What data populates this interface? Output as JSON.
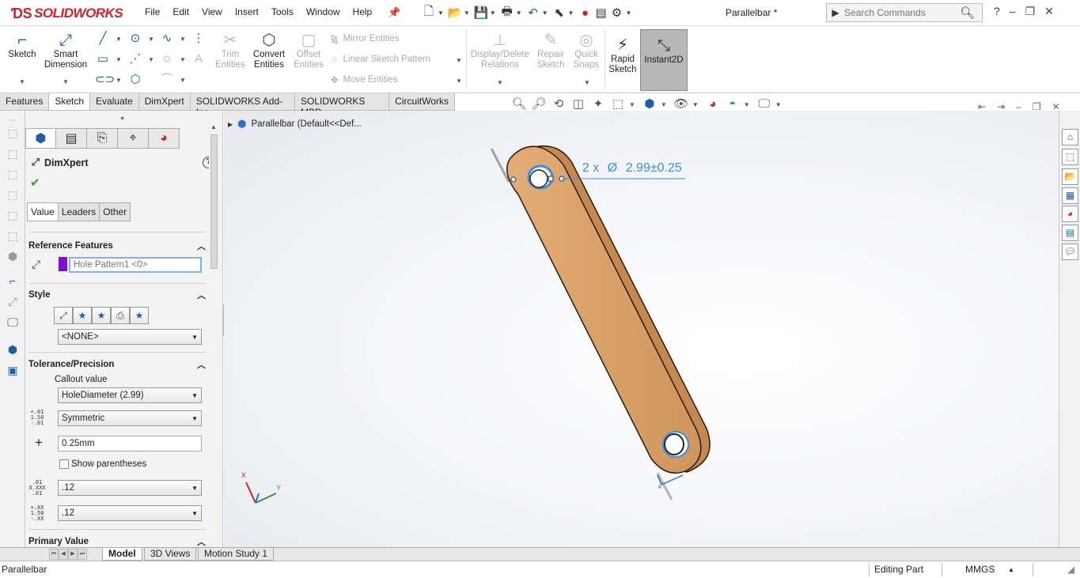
{
  "app": {
    "logo_text": "SOLIDWORKS",
    "document_title": "Parallelbar *",
    "menu": [
      "File",
      "Edit",
      "View",
      "Insert",
      "Tools",
      "Window",
      "Help"
    ],
    "search_placeholder": "Search Commands",
    "help_glyph": "?"
  },
  "ribbon": {
    "sketch": "Sketch",
    "smart_dimension_1": "Smart",
    "smart_dimension_2": "Dimension",
    "trim_1": "Trim",
    "trim_2": "Entities",
    "convert_1": "Convert",
    "convert_2": "Entities",
    "offset_1": "Offset",
    "offset_2": "Entities",
    "mirror": "Mirror Entities",
    "linear_pattern": "Linear Sketch Pattern",
    "move": "Move Entities",
    "display_delete_1": "Display/Delete",
    "display_delete_2": "Relations",
    "repair_1": "Repair",
    "repair_2": "Sketch",
    "quick_snaps_1": "Quick",
    "quick_snaps_2": "Snaps",
    "rapid_1": "Rapid",
    "rapid_2": "Sketch",
    "instant2d": "Instant2D"
  },
  "tabs": [
    "Features",
    "Sketch",
    "Evaluate",
    "DimXpert",
    "SOLIDWORKS Add-Ins",
    "SOLIDWORKS MBD",
    "CircuitWorks"
  ],
  "active_tab": "Sketch",
  "property_manager": {
    "title": "DimXpert",
    "subtabs": [
      "Value",
      "Leaders",
      "Other"
    ],
    "reference_features": {
      "heading": "Reference Features",
      "value": "Hole Pattern1 <0>",
      "swatch_color": "#7a10d8"
    },
    "style": {
      "heading": "Style",
      "selected": "<NONE>"
    },
    "tolerance": {
      "heading": "Tolerance/Precision",
      "callout_label": "Callout value",
      "callout_value": "HoleDiameter (2.99)",
      "tolerance_icon": "1.50",
      "tolerance_icon_sup": "+.01",
      "tolerance_icon_sub": "-.01",
      "tolerance_type": "Symmetric",
      "plus_sign": "+",
      "tolerance_value": "0.25mm",
      "show_parentheses": "Show parentheses",
      "precision_icon_a1": ".01",
      "precision_icon_a2": "X.XXX",
      "precision_icon_a3": ".01",
      "primary_precision": ".12",
      "precision_icon_b1": "+.XX",
      "precision_icon_b2": "1.50",
      "precision_icon_b3": "-.XX",
      "tolerance_precision": ".12"
    },
    "primary_value": {
      "heading": "Primary Value"
    }
  },
  "viewport": {
    "tree_label": "Parallelbar  (Default<<Def...",
    "dimension_prefix": "2 x",
    "dimension_symbol": "Ø",
    "dimension_value": "2.99±0.25",
    "triad_x": "X",
    "triad_y": "Y",
    "part_color": "#d9a068",
    "accent_blue": "#3a8ee6"
  },
  "bottom_tabs": [
    "Model",
    "3D Views",
    "Motion Study 1"
  ],
  "active_bottom_tab": "Model",
  "status": {
    "left": "Parallelbar",
    "mode": "Editing Part",
    "units": "MMGS"
  }
}
